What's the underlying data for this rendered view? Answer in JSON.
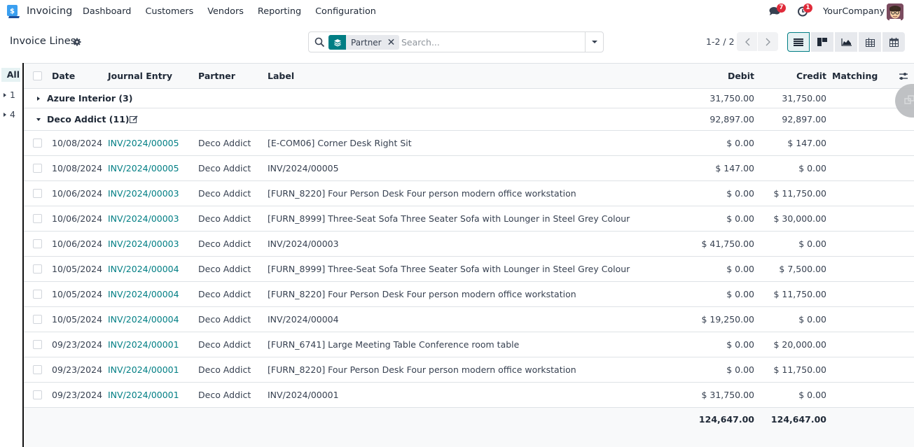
{
  "app": {
    "name": "Invoicing",
    "menu": [
      "Dashboard",
      "Customers",
      "Vendors",
      "Reporting",
      "Configuration"
    ],
    "brand_color": "#017e84"
  },
  "systray": {
    "messages_count": "7",
    "activities_count": "1",
    "company": "YourCompany"
  },
  "control_panel": {
    "title": "Invoice Lines",
    "search": {
      "facet_icon": "group-by-layers-icon",
      "facet_value": "Partner",
      "placeholder": "Search..."
    },
    "pager": "1-2 / 2",
    "views": [
      {
        "name": "list",
        "active": true
      },
      {
        "name": "kanban",
        "active": false
      },
      {
        "name": "graph",
        "active": false
      },
      {
        "name": "pivot",
        "active": false
      },
      {
        "name": "calendar",
        "active": false
      }
    ]
  },
  "left_panel": {
    "all_label": "All",
    "items": [
      "1",
      "4"
    ]
  },
  "table": {
    "columns": {
      "date": "Date",
      "journal_entry": "Journal Entry",
      "partner": "Partner",
      "label": "Label",
      "debit": "Debit",
      "credit": "Credit",
      "matching": "Matching"
    },
    "groups": [
      {
        "name": "Azure Interior (3)",
        "expanded": false,
        "debit": "31,750.00",
        "credit": "31,750.00"
      },
      {
        "name": "Deco Addict (11)",
        "expanded": true,
        "debit": "92,897.00",
        "credit": "92,897.00"
      }
    ],
    "rows": [
      {
        "date": "10/08/2024",
        "journal_entry": "INV/2024/00005",
        "partner": "Deco Addict",
        "label": "[E-COM06] Corner Desk Right Sit",
        "debit": "$ 0.00",
        "credit": "$ 147.00"
      },
      {
        "date": "10/08/2024",
        "journal_entry": "INV/2024/00005",
        "partner": "Deco Addict",
        "label": "INV/2024/00005",
        "debit": "$ 147.00",
        "credit": "$ 0.00"
      },
      {
        "date": "10/06/2024",
        "journal_entry": "INV/2024/00003",
        "partner": "Deco Addict",
        "label": "[FURN_8220] Four Person Desk Four person modern office workstation",
        "debit": "$ 0.00",
        "credit": "$ 11,750.00"
      },
      {
        "date": "10/06/2024",
        "journal_entry": "INV/2024/00003",
        "partner": "Deco Addict",
        "label": "[FURN_8999] Three-Seat Sofa Three Seater Sofa with Lounger in Steel Grey Colour",
        "debit": "$ 0.00",
        "credit": "$ 30,000.00"
      },
      {
        "date": "10/06/2024",
        "journal_entry": "INV/2024/00003",
        "partner": "Deco Addict",
        "label": "INV/2024/00003",
        "debit": "$ 41,750.00",
        "credit": "$ 0.00"
      },
      {
        "date": "10/05/2024",
        "journal_entry": "INV/2024/00004",
        "partner": "Deco Addict",
        "label": "[FURN_8999] Three-Seat Sofa Three Seater Sofa with Lounger in Steel Grey Colour",
        "debit": "$ 0.00",
        "credit": "$ 7,500.00"
      },
      {
        "date": "10/05/2024",
        "journal_entry": "INV/2024/00004",
        "partner": "Deco Addict",
        "label": "[FURN_8220] Four Person Desk Four person modern office workstation",
        "debit": "$ 0.00",
        "credit": "$ 11,750.00"
      },
      {
        "date": "10/05/2024",
        "journal_entry": "INV/2024/00004",
        "partner": "Deco Addict",
        "label": "INV/2024/00004",
        "debit": "$ 19,250.00",
        "credit": "$ 0.00"
      },
      {
        "date": "09/23/2024",
        "journal_entry": "INV/2024/00001",
        "partner": "Deco Addict",
        "label": "[FURN_6741] Large Meeting Table Conference room table",
        "debit": "$ 0.00",
        "credit": "$ 20,000.00"
      },
      {
        "date": "09/23/2024",
        "journal_entry": "INV/2024/00001",
        "partner": "Deco Addict",
        "label": "[FURN_8220] Four Person Desk Four person modern office workstation",
        "debit": "$ 0.00",
        "credit": "$ 11,750.00"
      },
      {
        "date": "09/23/2024",
        "journal_entry": "INV/2024/00001",
        "partner": "Deco Addict",
        "label": "INV/2024/00001",
        "debit": "$ 31,750.00",
        "credit": "$ 0.00"
      }
    ],
    "totals": {
      "debit": "124,647.00",
      "credit": "124,647.00"
    }
  }
}
